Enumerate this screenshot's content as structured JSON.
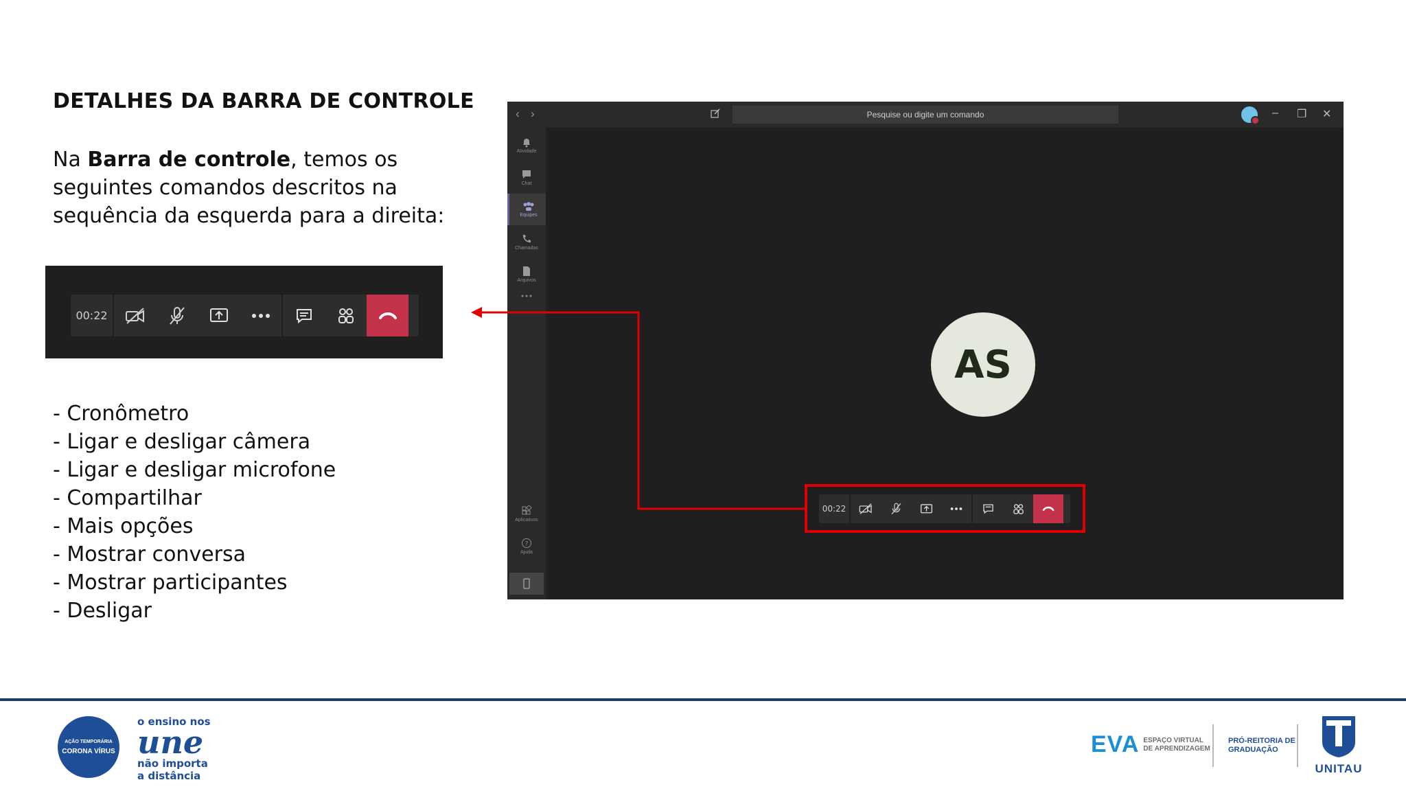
{
  "slide": {
    "title": "DETALHES DA BARRA DE CONTROLE",
    "intro_prefix": "Na ",
    "intro_bold": "Barra de controle",
    "intro_suffix": ", temos os seguintes comandos descritos na sequência da esquerda para a direita:",
    "list": [
      "- Cronômetro",
      "- Ligar e desligar câmera",
      "- Ligar e desligar microfone",
      "- Compartilhar",
      "- Mais opções",
      "- Mostrar conversa",
      "- Mostrar participantes",
      "- Desligar"
    ]
  },
  "control_bar": {
    "timer": "00:22",
    "buttons": [
      "camera-off-icon",
      "mic-off-icon",
      "share-icon",
      "more-icon",
      "chat-icon",
      "participants-icon",
      "hangup-icon"
    ]
  },
  "teams": {
    "search_placeholder": "Pesquise ou digite um comando",
    "rail": [
      "Atividade",
      "Chat",
      "Equipes",
      "Chamadas",
      "Arquivos",
      "Aplicativos",
      "Ajuda"
    ],
    "participant_initials": "AS",
    "colors": {
      "accent": "#6264a7",
      "hangup": "#c4314b",
      "highlight": "#e00000"
    }
  },
  "footer": {
    "seal_line1": "AÇÃO TEMPORÁRIA",
    "seal_line2": "CORONA VÍRUS",
    "slogan_top": "o ensino nos",
    "slogan_mid": "une",
    "slogan_bottom1": "não importa",
    "slogan_bottom2": "a distância",
    "eva": "EVA",
    "eva_sub1": "ESPAÇO VIRTUAL",
    "eva_sub2": "DE APRENDIZAGEM",
    "prg1": "PRÓ-REITORIA DE",
    "prg2": "GRADUAÇÃO",
    "unitau": "UNITAU"
  }
}
